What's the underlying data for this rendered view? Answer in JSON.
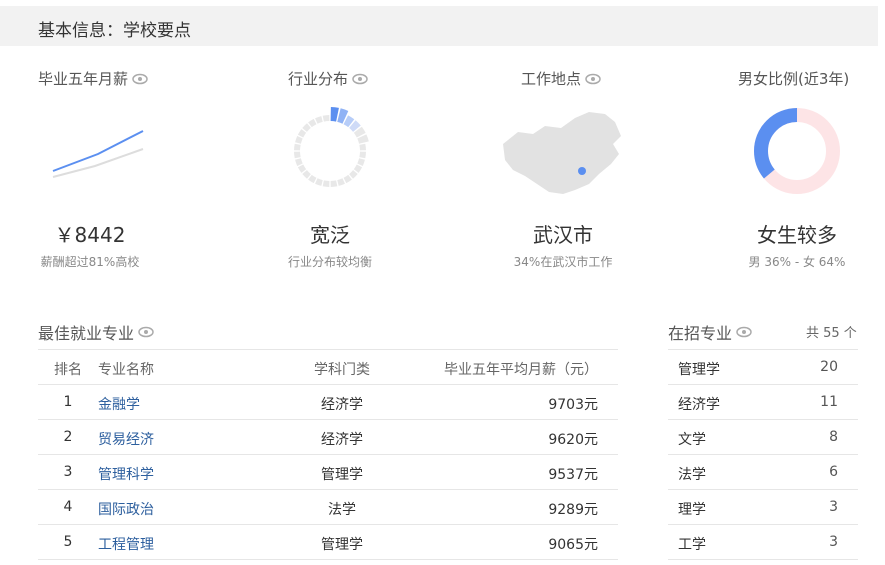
{
  "header": {
    "title": "基本信息：学校要点"
  },
  "stats": [
    {
      "label": "毕业五年月薪",
      "value": "￥8442",
      "sub": "薪酬超过81%高校"
    },
    {
      "label": "行业分布",
      "value": "宽泛",
      "sub": "行业分布较均衡"
    },
    {
      "label": "工作地点",
      "value": "武汉市",
      "sub": "34%在武汉市工作"
    },
    {
      "label": "男女比例(近3年)",
      "value": "女生较多",
      "sub": "男 36% - 女 64%"
    }
  ],
  "gender_ratio": {
    "male_percent": 36,
    "female_percent": 64
  },
  "best_majors": {
    "title": "最佳就业专业",
    "headers": {
      "rank": "排名",
      "name": "专业名称",
      "category": "学科门类",
      "salary": "毕业五年平均月薪（元）"
    },
    "rows": [
      {
        "rank": "1",
        "name": "金融学",
        "category": "经济学",
        "salary": "9703元"
      },
      {
        "rank": "2",
        "name": "贸易经济",
        "category": "经济学",
        "salary": "9620元"
      },
      {
        "rank": "3",
        "name": "管理科学",
        "category": "管理学",
        "salary": "9537元"
      },
      {
        "rank": "4",
        "name": "国际政治",
        "category": "法学",
        "salary": "9289元"
      },
      {
        "rank": "5",
        "name": "工程管理",
        "category": "管理学",
        "salary": "9065元"
      }
    ]
  },
  "enrolling": {
    "title": "在招专业",
    "total": "共 55 个",
    "rows": [
      {
        "name": "管理学",
        "count": "20"
      },
      {
        "name": "经济学",
        "count": "11"
      },
      {
        "name": "文学",
        "count": "8"
      },
      {
        "name": "法学",
        "count": "6"
      },
      {
        "name": "理学",
        "count": "3"
      },
      {
        "name": "工学",
        "count": "3"
      }
    ]
  },
  "colors": {
    "accent": "#5b8ff0",
    "link": "#2d5f9e",
    "female": "#fde4e6",
    "grey": "#e5e5e5"
  }
}
